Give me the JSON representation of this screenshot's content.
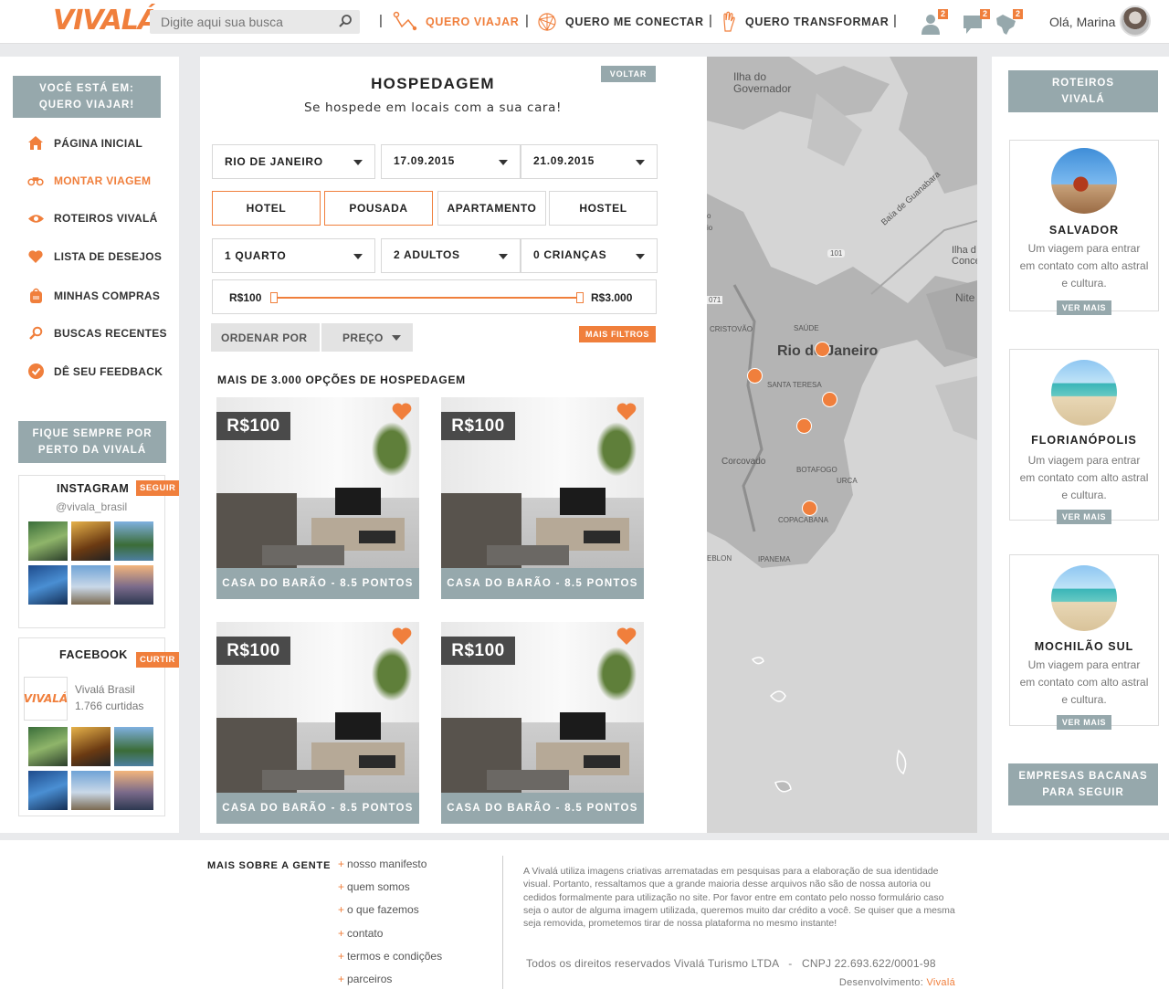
{
  "header": {
    "logo": "VIVALÁ",
    "search_placeholder": "Digite aqui sua busca",
    "nav": {
      "viajar": "QUERO VIAJAR",
      "conectar": "QUERO ME CONECTAR",
      "transformar": "QUERO TRANSFORMAR"
    },
    "badges": {
      "friends": "2",
      "messages": "2",
      "map": "2"
    },
    "greeting": "Olá, Marina"
  },
  "sidebar": {
    "you_are": "VOCÊ ESTÁ EM:",
    "you_are_place": "QUERO VIAJAR!",
    "items": [
      {
        "label": "PÁGINA INICIAL",
        "icon": "home-icon"
      },
      {
        "label": "MONTAR VIAGEM",
        "icon": "binoculars-icon"
      },
      {
        "label": "ROTEIROS VIVALÁ",
        "icon": "eye-icon"
      },
      {
        "label": "LISTA DE DESEJOS",
        "icon": "heart-icon"
      },
      {
        "label": "MINHAS COMPRAS",
        "icon": "backpack-icon"
      },
      {
        "label": "BUSCAS RECENTES",
        "icon": "search-icon"
      },
      {
        "label": "DÊ SEU FEEDBACK",
        "icon": "check-icon"
      }
    ],
    "stay_close_1": "FIQUE SEMPRE POR",
    "stay_close_2": "PERTO DA VIVALÁ",
    "instagram": {
      "title": "INSTAGRAM",
      "action": "SEGUIR",
      "handle": "@vivala_brasil"
    },
    "facebook": {
      "title": "FACEBOOK",
      "action": "CURTIR",
      "page": "Vivalá Brasil",
      "likes": "1.766 curtidas",
      "logo": "VIVALÁ"
    }
  },
  "main": {
    "title": "HOSPEDAGEM",
    "subtitle": "Se hospede em locais com a sua cara!",
    "back": "VOLTAR",
    "city": "RIO DE JANEIRO",
    "checkin": "17.09.2015",
    "checkout": "21.09.2015",
    "types": [
      "HOTEL",
      "POUSADA",
      "APARTAMENTO",
      "HOSTEL"
    ],
    "rooms": "1 QUARTO",
    "adults": "2 ADULTOS",
    "children": "0 CRIANÇAS",
    "price_min": "R$100",
    "price_max": "R$3.000",
    "sort_label": "ORDENAR POR",
    "sort_value": "PREÇO",
    "more_filters": "MAIS FILTROS",
    "count": "MAIS DE 3.000 OPÇÕES DE HOSPEDAGEM",
    "listings": [
      {
        "price": "R$100",
        "name": "CASA DO BARÃO - 8.5 PONTOS"
      },
      {
        "price": "R$100",
        "name": "CASA DO BARÃO - 8.5 PONTOS"
      },
      {
        "price": "R$100",
        "name": "CASA DO BARÃO - 8.5 PONTOS"
      },
      {
        "price": "R$100",
        "name": "CASA DO BARÃO - 8.5 PONTOS"
      }
    ]
  },
  "map": {
    "labels": {
      "governador": "Ilha do\nGovernador",
      "baia": "Baía de Guanabara",
      "rio": "Rio de Janeiro",
      "santa_teresa": "SANTA TERESA",
      "corcovado": "Corcovado",
      "botafogo": "BOTAFOGO",
      "copacabana": "COPACABANA",
      "ipanema": "IPANEMA",
      "niteroi": "Nite",
      "saude": "SAÚDE",
      "cristovao": "CRISTOVÃO",
      "ilha_conc": "Ilha d\nConcei",
      "r101": "101",
      "r071": "071",
      "leblon": "EBLON",
      "urca": "URCA",
      "io": "io",
      "o": "o"
    }
  },
  "right": {
    "roteiros_1": "ROTEIROS",
    "roteiros_2": "VIVALÁ",
    "cards": [
      {
        "name": "SALVADOR",
        "desc": "Um viagem para entrar em contato com alto astral e cultura.",
        "action": "VER MAIS"
      },
      {
        "name": "FLORIANÓPOLIS",
        "desc": "Um viagem para entrar em contato com alto astral e cultura.",
        "action": "VER MAIS"
      },
      {
        "name": "MOCHILÃO SUL",
        "desc": "Um viagem para entrar em contato com alto astral e cultura.",
        "action": "VER MAIS"
      }
    ],
    "empresas_1": "EMPRESAS BACANAS",
    "empresas_2": "PARA SEGUIR"
  },
  "footer": {
    "heading": "MAIS SOBRE A GENTE",
    "links": [
      "nosso manifesto",
      "quem somos",
      "o que fazemos",
      "contato",
      "termos e condições",
      "parceiros"
    ],
    "note": "A Vivalá utiliza imagens criativas arrematadas em pesquisas para a elaboração de sua identidade visual. Portanto, ressaltamos que a grande maioria desse arquivos não são de nossa autoria ou cedidos formalmente para utilização no site. Por favor entre em contato pelo nosso formulário caso seja o autor de alguma imagem utilizada, queremos muito dar crédito a você. Se quiser que a mesma seja removida, prometemos tirar de nossa plataforma no mesmo instante!",
    "rights": "Todos os direitos reservados Vivalá Turismo LTDA   -   CNPJ 22.693.622/0001-98",
    "dev_label": "Desenvolvimento:",
    "dev_name": "Vivalá"
  },
  "colors": {
    "accent": "#f07f3c",
    "gray_blue": "#96a8ac",
    "map": "#d5d5d5"
  }
}
